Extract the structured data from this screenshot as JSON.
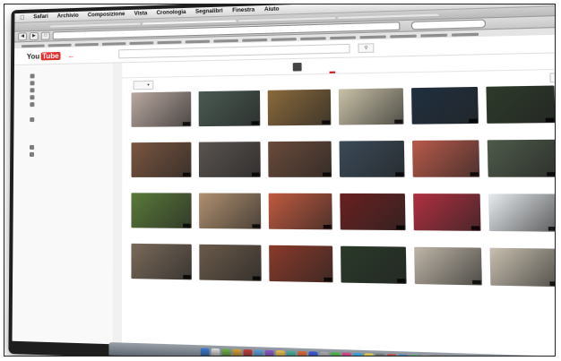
{
  "menubar": {
    "apple": "",
    "items": [
      "Safari",
      "Archivio",
      "Composizione",
      "Vista",
      "Cronologia",
      "Segnalibri",
      "Finestra",
      "Aiuto"
    ]
  },
  "tabs": [
    "",
    "",
    "",
    ""
  ],
  "urlbar": {
    "value": ""
  },
  "youtube": {
    "logo_you": "You",
    "logo_tube": "Tube"
  },
  "colors": {
    "thumbs": [
      "#b8a8a0",
      "#4a5a52",
      "#8a6a3c",
      "#c9c2a8",
      "#203040",
      "#2d3a2a",
      "#7a5640",
      "#5a5450",
      "#6a4a3a",
      "#3a4a58",
      "#b85a4a",
      "#4e5a4a",
      "#5a7a3a",
      "#b09070",
      "#c05a40",
      "#6a2020",
      "#b03040",
      "#e8ecef",
      "#7a6a5a",
      "#6a5a4a",
      "#8a3a2a",
      "#2a3a2a",
      "#bfb6a8",
      "#c8c0b0"
    ],
    "dock": [
      "#3a7bd5",
      "#e0e0e0",
      "#6fb34a",
      "#d9a23a",
      "#c43a3a",
      "#5aa0d8",
      "#8a5ac8",
      "#e8c04a",
      "#4ab0a0",
      "#d86a3a",
      "#3a5ad8",
      "#aaaaaa",
      "#50b850",
      "#d84a8a",
      "#3aa8e0",
      "#e0d050",
      "#7a7a7a",
      "#c85050",
      "#4a8ad0",
      "#60c080",
      "#b0b0b0",
      "#e07030",
      "#5050c0",
      "#90c040",
      "#d0d0d0",
      "#3070b0"
    ]
  }
}
